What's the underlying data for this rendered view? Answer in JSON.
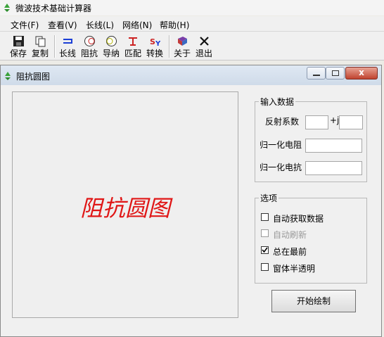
{
  "app": {
    "title": "微波技术基础计算器"
  },
  "menu": [
    "文件(F)",
    "查看(V)",
    "长线(L)",
    "网络(N)",
    "帮助(H)"
  ],
  "toolbar": {
    "save": "保存",
    "copy": "复制",
    "line": "长线",
    "impedance": "阻抗",
    "admittance": "导纳",
    "matching": "匹配",
    "convert": "转换",
    "about": "关于",
    "exit": "退出"
  },
  "window": {
    "title": "阻抗圆图",
    "close_glyph": "x"
  },
  "chart": {
    "label": "阻抗圆图",
    "label_color": "#e01616"
  },
  "input_group": {
    "title": "输入数据",
    "reflection_label": "反射系数",
    "imag_label": "+j",
    "reflection_real": "",
    "reflection_imag": "",
    "resistance_label": "归一化电阻",
    "resistance_value": "",
    "reactance_label": "归一化电抗",
    "reactance_value": ""
  },
  "options_group": {
    "title": "选项",
    "items": [
      {
        "label": "自动获取数据",
        "checked": false,
        "enabled": true
      },
      {
        "label": "自动刷新",
        "checked": false,
        "enabled": false
      },
      {
        "label": "总在最前",
        "checked": true,
        "enabled": true
      },
      {
        "label": "窗体半透明",
        "checked": false,
        "enabled": true
      }
    ]
  },
  "draw_button": {
    "label": "开始绘制"
  }
}
